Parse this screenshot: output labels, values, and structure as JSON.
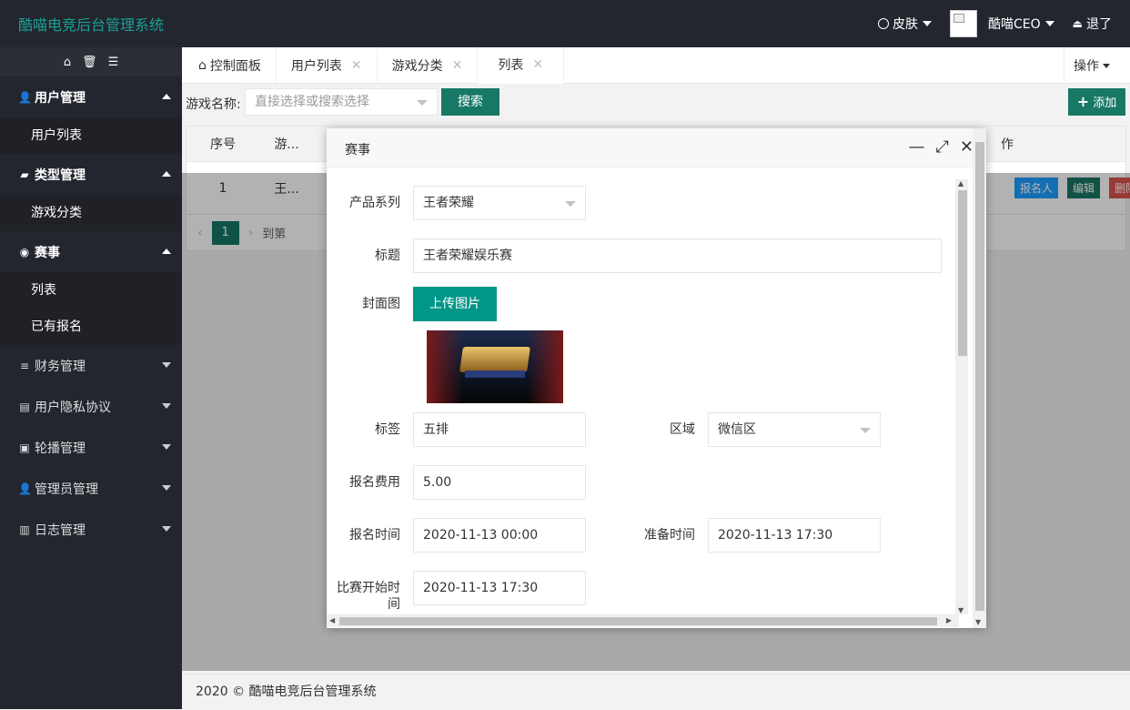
{
  "app": {
    "title": "酷喵电竞后台管理系统"
  },
  "topnav": {
    "skin": "皮肤",
    "user": "酷喵CEO",
    "logout": "退了"
  },
  "sidebar": {
    "groups": [
      {
        "label": "用户管理",
        "icon": "user-icon",
        "expanded": true,
        "items": [
          "用户列表"
        ]
      },
      {
        "label": "类型管理",
        "icon": "folder-icon",
        "expanded": true,
        "items": [
          "游戏分类"
        ]
      },
      {
        "label": "赛事",
        "icon": "gamepad-icon",
        "expanded": true,
        "items": [
          "列表",
          "已有报名"
        ]
      },
      {
        "label": "财务管理",
        "icon": "list-icon",
        "expanded": false
      },
      {
        "label": "用户隐私协议",
        "icon": "archive-icon",
        "expanded": false
      },
      {
        "label": "轮播管理",
        "icon": "image-icon",
        "expanded": false
      },
      {
        "label": "管理员管理",
        "icon": "user-icon",
        "expanded": false
      },
      {
        "label": "日志管理",
        "icon": "book-icon",
        "expanded": false
      }
    ]
  },
  "tabs": [
    {
      "label": "控制面板",
      "icon": "home-icon"
    },
    {
      "label": "用户列表"
    },
    {
      "label": "游戏分类"
    },
    {
      "label": "列表",
      "active": true
    }
  ],
  "ops_label": "操作",
  "toolbar": {
    "game_label": "游戏名称:",
    "select_placeholder": "直接选择或搜索选择",
    "search": "搜索",
    "add": "添加"
  },
  "table": {
    "headers": [
      "序号",
      "游...",
      "作"
    ],
    "rows": [
      {
        "index": "1",
        "game": "王..."
      }
    ],
    "actions": {
      "signup": "报名人",
      "edit": "编辑",
      "delete": "删除"
    }
  },
  "pager": {
    "page": "1",
    "goto": "到第"
  },
  "modal": {
    "title": "赛事",
    "fields": {
      "product_series_label": "产品系列",
      "product_series_value": "王者荣耀",
      "title_label": "标题",
      "title_value": "王者荣耀娱乐赛",
      "cover_label": "封面图",
      "upload": "上传图片",
      "tag_label": "标签",
      "tag_value": "五排",
      "region_label": "区域",
      "region_value": "微信区",
      "fee_label": "报名费用",
      "fee_value": "5.00",
      "signup_time_label": "报名时间",
      "signup_time_value": "2020-11-13 00:00",
      "prep_time_label": "准备时间",
      "prep_time_value": "2020-11-13 17:30",
      "start_time_label": "比赛开始时间",
      "start_time_value": "2020-11-13 17:30"
    }
  },
  "footer": "2020 © 酷喵电竞后台管理系统",
  "colors": {
    "accent": "#009688",
    "dark": "#23262e",
    "brand": "#1aa094",
    "blue": "#1e9fff",
    "red": "#d9534f"
  }
}
